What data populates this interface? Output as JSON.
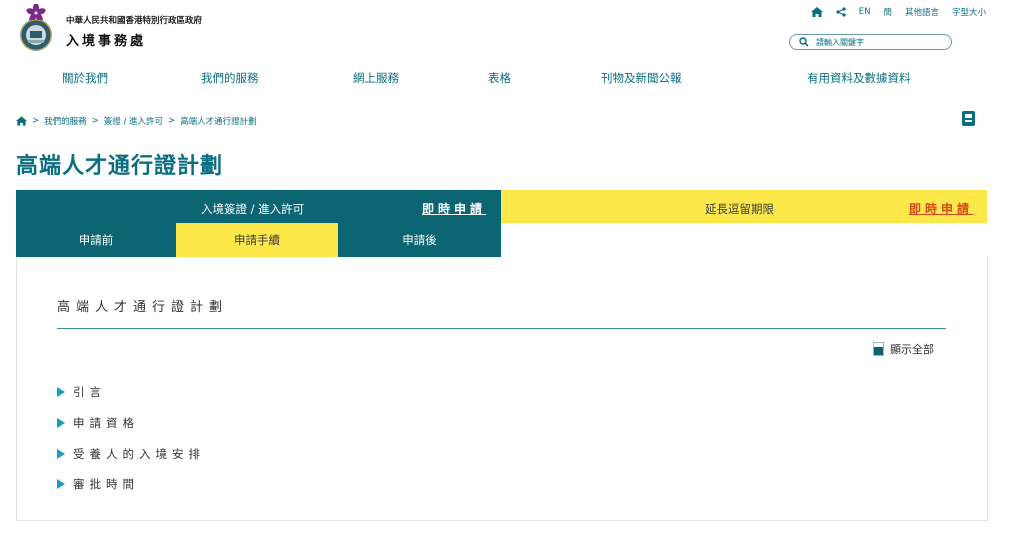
{
  "header": {
    "gov_name": "中華人民共和國香港特別行政區政府",
    "dept_name": "入境事務處",
    "top_links": {
      "lang_en": "EN",
      "lang_sc": "簡",
      "other_lang": "其他語言",
      "font_size": "字型大小"
    },
    "search_placeholder": "請輸入關鍵字"
  },
  "nav": [
    "關於我們",
    "我們的服務",
    "網上服務",
    "表格",
    "刊物及新聞公報",
    "有用資料及數據資料"
  ],
  "breadcrumb": [
    "我們的服務",
    "簽證 / 進入許可",
    "高端人才通行證計劃"
  ],
  "page_title": "高端人才通行證計劃",
  "tabs": {
    "visa_label": "入境簽證 / 進入許可",
    "visa_apply": "即時申請",
    "extend_label": "延長逗留期限",
    "extend_apply": "即時申請",
    "sub": [
      "申請前",
      "申請手續",
      "申請後"
    ]
  },
  "panel": {
    "title": "高端人才通行證計劃",
    "show_all": "顯示全部",
    "items": [
      "引言",
      "申請資格",
      "受養人的入境安排",
      "審批時間"
    ]
  },
  "colors": {
    "primary": "#0b6572",
    "link": "#0a6e82",
    "yellow": "#fde84a",
    "apply_red": "#d6491c",
    "bullet": "#1a9bc0"
  },
  "icons": [
    "hk-emblem-logo",
    "home-icon",
    "share-icon",
    "search-icon",
    "print-icon"
  ]
}
